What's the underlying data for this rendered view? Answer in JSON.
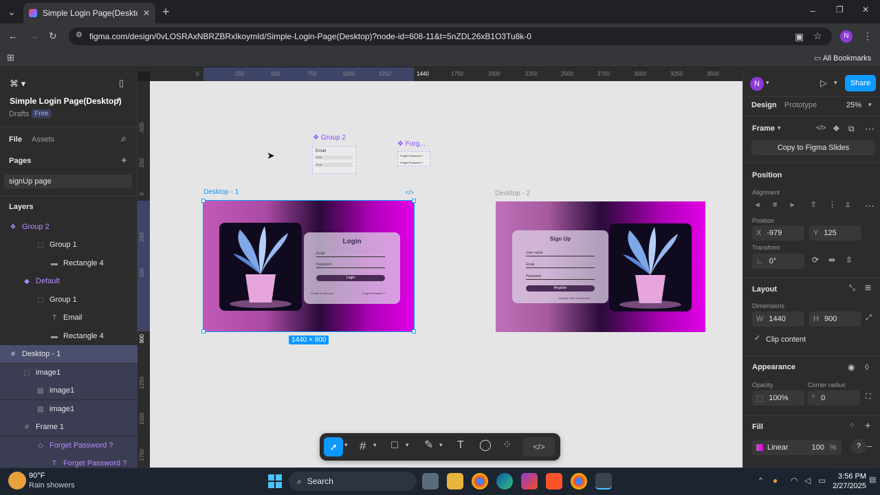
{
  "browser": {
    "tab_title": "Simple Login Page(Desktop) – Figma",
    "url": "figma.com/design/0vLOSRAxNBRZBRxIkoymId/Simple-Login-Page(Desktop)?node-id=608-11&t=5nZDL26xB1O3Tu8k-0",
    "bookmarks_label": "All Bookmarks",
    "profile_initial": "N"
  },
  "figma": {
    "file_name": "Simple Login Page(Desktop)",
    "drafts": "Drafts",
    "plan_badge": "Free",
    "tabs": {
      "file": "File",
      "assets": "Assets"
    },
    "pages_label": "Pages",
    "current_page": "signUp page",
    "layers_label": "Layers",
    "layers": [
      {
        "label": "Group 2",
        "kind": "component"
      },
      {
        "label": "Group 1",
        "kind": "group"
      },
      {
        "label": "Rectangle 4",
        "kind": "rect"
      },
      {
        "label": "Default",
        "kind": "component"
      },
      {
        "label": "Group 1",
        "kind": "group"
      },
      {
        "label": "Email",
        "kind": "text"
      },
      {
        "label": "Rectangle 4",
        "kind": "rect"
      },
      {
        "label": "Desktop - 1",
        "kind": "frame"
      },
      {
        "label": "image1",
        "kind": "group"
      },
      {
        "label": "image1",
        "kind": "image"
      },
      {
        "label": "image1",
        "kind": "image"
      },
      {
        "label": "Frame 1",
        "kind": "frame"
      },
      {
        "label": "Forget Password ?",
        "kind": "component"
      },
      {
        "label": "Forget Password ?",
        "kind": "text"
      }
    ]
  },
  "rulers": {
    "top": [
      "0",
      "250",
      "500",
      "750",
      "1000",
      "1250",
      "1440",
      "1750",
      "2000",
      "2250",
      "2500",
      "2750",
      "3000",
      "3250",
      "3500"
    ],
    "left": [
      "-500",
      "-250",
      "0",
      "250",
      "500",
      "900",
      "1250",
      "1500",
      "1750"
    ]
  },
  "canvas": {
    "group2_label": "Group 2",
    "group2_lines": [
      "Email",
      "Emai",
      "Emai"
    ],
    "forgot_label": "Forg...",
    "forgot_lines": [
      "Forget Password ?",
      "Forget Password ?"
    ],
    "frame1_label": "Desktop - 1",
    "frame1_code_icon": "</>",
    "frame1_size": "1440 × 900",
    "frame2_label": "Desktop - 2",
    "login": {
      "title": "Login",
      "email": "Email",
      "password": "Password",
      "button": "Login",
      "link_left": "Create an Account",
      "link_right": "Forget Password ?"
    },
    "signup": {
      "title": "Sign Up",
      "username": "User name",
      "email": "Email",
      "password": "Password",
      "button": "Register",
      "link": "Already have an account?"
    }
  },
  "right_panel": {
    "avatar": "N",
    "share": "Share",
    "tab_design": "Design",
    "tab_prototype": "Prototype",
    "zoom": "25%",
    "frame_label": "Frame",
    "copy_slides": "Copy to Figma Slides",
    "position_title": "Position",
    "alignment_label": "Alignment",
    "position_label": "Position",
    "x_label": "X",
    "x_value": "-979",
    "y_label": "Y",
    "y_value": "125",
    "transform_label": "Transform",
    "rotation": "0°",
    "layout_title": "Layout",
    "dimensions_label": "Dimensions",
    "w_label": "W",
    "w_value": "1440",
    "h_label": "H",
    "h_value": "900",
    "clip_content": "Clip content",
    "appearance_title": "Appearance",
    "opacity_label": "Opacity",
    "opacity_value": "100%",
    "radius_label": "Corner radius",
    "radius_value": "0",
    "fill_title": "Fill",
    "fill_type": "Linear",
    "fill_opacity": "100",
    "fill_pct": "%"
  },
  "taskbar": {
    "weather_temp": "90°F",
    "weather_desc": "Rain showers",
    "search": "Search",
    "time": "3:56 PM",
    "date": "2/27/2025"
  },
  "colors": {
    "figma_accent": "#0d99ff",
    "component_purple": "#b68cff",
    "frame_magenta": "#e100e6"
  }
}
